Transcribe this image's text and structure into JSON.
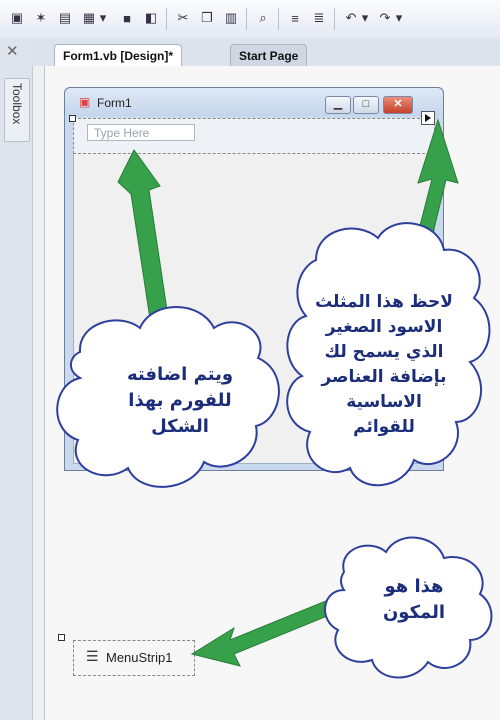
{
  "toolbar": {
    "icons": [
      "add-project-icon",
      "new-item-icon",
      "open-folder-icon",
      "add-item-icon",
      "dropdown-icon",
      "save-icon",
      "save-all-icon",
      "cut-icon",
      "copy-icon",
      "paste-icon",
      "find-icon",
      "comment-icon",
      "uncomment-icon",
      "undo-icon",
      "undo-dropdown-icon",
      "redo-icon",
      "redo-dropdown-icon"
    ]
  },
  "side_panel": {
    "toolbox_label": "Toolbox"
  },
  "tabs": [
    {
      "label": "Form1.vb [Design]*"
    },
    {
      "label": "Start Page"
    }
  ],
  "form": {
    "title": "Form1",
    "menu_placeholder": "Type Here"
  },
  "tray": {
    "component_label": "MenuStrip1"
  },
  "callouts": {
    "left": [
      "ويتم اضافته",
      "للفورم بهذا",
      "الشكل"
    ],
    "right": [
      "لاحظ هذا المثلث",
      "الاسود الصغير",
      "الذي يسمح لك",
      "بإضافة العناصر",
      "الاساسية",
      "للقوائم"
    ],
    "bottom": [
      "هذا هو",
      "المكون"
    ]
  },
  "colors": {
    "arrow_green": "#36a14a",
    "cloud_fill": "#ffffff",
    "cloud_stroke": "#2e3f9e",
    "callout_text": "#1c2d7a"
  }
}
